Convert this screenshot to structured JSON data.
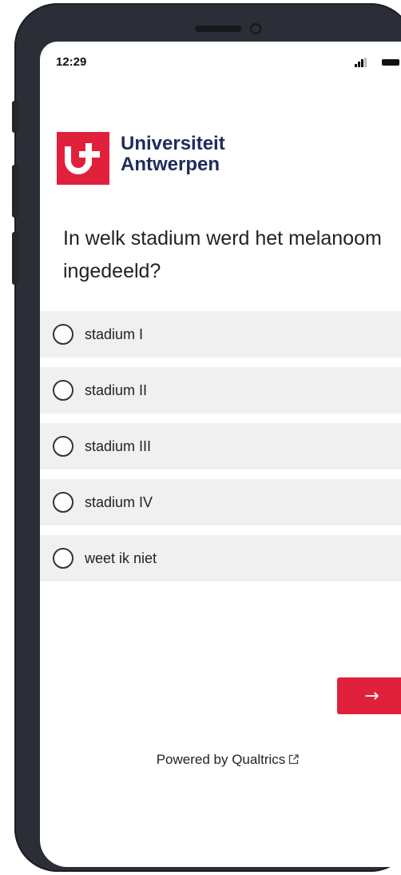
{
  "status_bar": {
    "time": "12:29",
    "signal_icon": "signal-bars-icon",
    "battery_icon": "battery-icon"
  },
  "logo": {
    "line1": "Universiteit",
    "line2": "Antwerpen",
    "mark_icon": "universiteit-antwerpen-mark",
    "brand_color": "#e1213b",
    "text_color": "#1f2b5b"
  },
  "question": {
    "text": "In welk stadium werd het melanoom ingedeeld?"
  },
  "options": [
    {
      "label": "stadium I",
      "selected": false
    },
    {
      "label": "stadium II",
      "selected": false
    },
    {
      "label": "stadium III",
      "selected": false
    },
    {
      "label": "stadium IV",
      "selected": false
    },
    {
      "label": "weet ik niet",
      "selected": false
    }
  ],
  "navigation": {
    "next_label": "→",
    "next_color": "#e1213b"
  },
  "footer": {
    "powered_by": "Powered by Qualtrics",
    "external_icon": "external-link-icon"
  }
}
